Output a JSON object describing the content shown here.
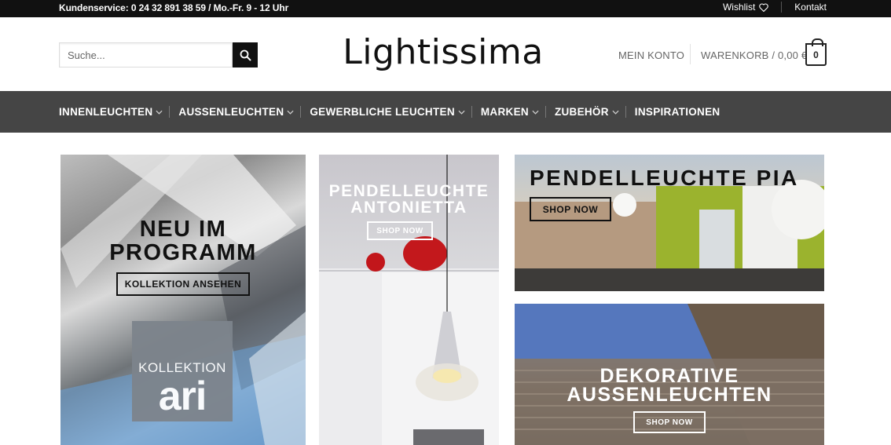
{
  "topbar": {
    "service": "Kundenservice: 0 24 32 891 38 59 / Mo.-Fr. 9 - 12 Uhr",
    "wishlist": "Wishlist",
    "contact": "Kontakt"
  },
  "header": {
    "search_placeholder": "Suche...",
    "logo_text": "Lightissima",
    "account": "MEIN KONTO",
    "cart": "WARENKORB / 0,00 €",
    "cart_count": "0"
  },
  "nav": {
    "items": [
      {
        "label": "INNENLEUCHTEN",
        "icon": "chevron-down-icon"
      },
      {
        "label": "AUSSENLEUCHTEN",
        "icon": "chevron-down-icon"
      },
      {
        "label": "GEWERBLICHE LEUCHTEN",
        "icon": "chevron-down-icon"
      },
      {
        "label": "MARKEN",
        "icon": "chevron-down-icon"
      },
      {
        "label": "ZUBEHÖR",
        "icon": "chevron-down-icon"
      },
      {
        "label": "INSPIRATIONEN"
      }
    ]
  },
  "tiles": {
    "t1": {
      "title_1": "NEU IM",
      "title_2": "PROGRAMM",
      "button": "KOLLEKTION ANSEHEN",
      "badge_small": "KOLLEKTION",
      "badge_big": "ari"
    },
    "t2": {
      "title_1": "PENDELLEUCHTE",
      "title_2": "ANTONIETTA",
      "button": "SHOP NOW"
    },
    "t3": {
      "title": "PENDELLEUCHTE PIA",
      "button": "SHOP NOW"
    },
    "t4": {
      "title_1": "DEKORATIVE",
      "title_2": "AUSSENLEUCHTEN",
      "button": "SHOP NOW"
    }
  },
  "colors": {
    "topbar_bg": "#111111",
    "nav_bg": "#454545",
    "text_muted": "#666666"
  }
}
